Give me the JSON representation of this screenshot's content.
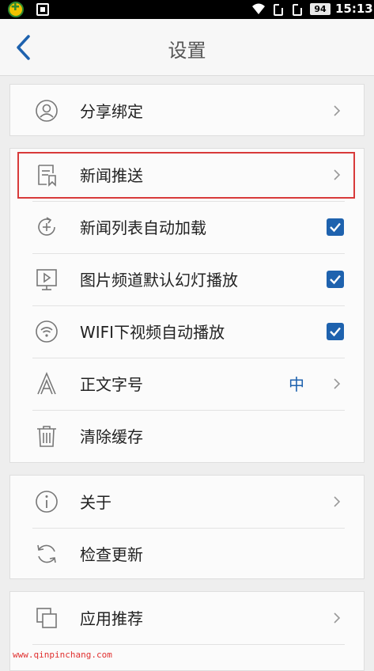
{
  "status_bar": {
    "battery": "94",
    "time": "15:13",
    "icons": [
      "app-notification-icon",
      "screenshot-icon",
      "wifi-icon",
      "sim-card-icon",
      "sim-card-icon",
      "battery-icon"
    ]
  },
  "header": {
    "title": "设置",
    "back_icon": "chevron-left-icon"
  },
  "section1": {
    "items": [
      {
        "label": "分享绑定",
        "icon": "user-circle-icon",
        "trailing": "chevron"
      }
    ]
  },
  "section2": {
    "items": [
      {
        "label": "新闻推送",
        "icon": "news-bookmark-icon",
        "trailing": "chevron"
      },
      {
        "label": "新闻列表自动加载",
        "icon": "refresh-plus-icon",
        "trailing": "checkbox",
        "checked": true
      },
      {
        "label": "图片频道默认幻灯播放",
        "icon": "slideshow-play-icon",
        "trailing": "checkbox",
        "checked": true
      },
      {
        "label": "WIFI下视频自动播放",
        "icon": "wifi-circle-icon",
        "trailing": "checkbox",
        "checked": true
      },
      {
        "label": "正文字号",
        "icon": "font-size-icon",
        "trailing": "chevron",
        "value": "中"
      },
      {
        "label": "清除缓存",
        "icon": "trash-icon",
        "trailing": "none"
      }
    ]
  },
  "section3": {
    "items": [
      {
        "label": "关于",
        "icon": "info-circle-icon",
        "trailing": "chevron"
      },
      {
        "label": "检查更新",
        "icon": "sync-icon",
        "trailing": "none"
      }
    ]
  },
  "section4": {
    "items": [
      {
        "label": "应用推荐",
        "icon": "app-layers-icon",
        "trailing": "chevron"
      }
    ]
  },
  "watermark": "www.qinpinchang.com",
  "colors": {
    "accent": "#1e62ae",
    "highlight_border": "#d83a3a",
    "watermark": "#e0302f"
  }
}
